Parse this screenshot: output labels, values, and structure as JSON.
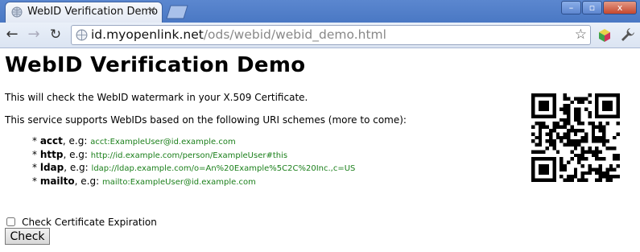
{
  "browser": {
    "tab_title": "WebID Verification Demo",
    "url_host": "id.myopenlink.net",
    "url_path": "/ods/webid/webid_demo.html",
    "window_buttons": {
      "minimize": "–",
      "maximize": "▫",
      "close": "x"
    }
  },
  "page": {
    "title": "WebID Verification Demo",
    "intro": "This will check the WebID watermark in your X.509 Certificate.",
    "supports": "This service supports WebIDs based on the following URI schemes (more to come):",
    "schemes": [
      {
        "name": "acct",
        "eg": ", e.g:",
        "example": "acct:ExampleUser@id.example.com"
      },
      {
        "name": "http",
        "eg": ", e.g:",
        "example": "http://id.example.com/person/ExampleUser#this"
      },
      {
        "name": "ldap",
        "eg": ", e.g:",
        "example": "ldap://ldap.example.com/o=An%20Example%5C2C%20Inc.,c=US"
      },
      {
        "name": "mailto",
        "eg": ", e.g:",
        "example": "mailto:ExampleUser@id.example.com"
      }
    ],
    "check_expiration_label": "Check Certificate Expiration",
    "check_button": "Check"
  },
  "colors": {
    "example_text": "#1a7f1a",
    "titlebar": "#4a78c4"
  },
  "icons": [
    "globe-icon",
    "close-icon",
    "new-tab-icon",
    "back-icon",
    "forward-icon",
    "reload-icon",
    "star-icon",
    "extension-icon",
    "wrench-icon",
    "qr-code"
  ]
}
